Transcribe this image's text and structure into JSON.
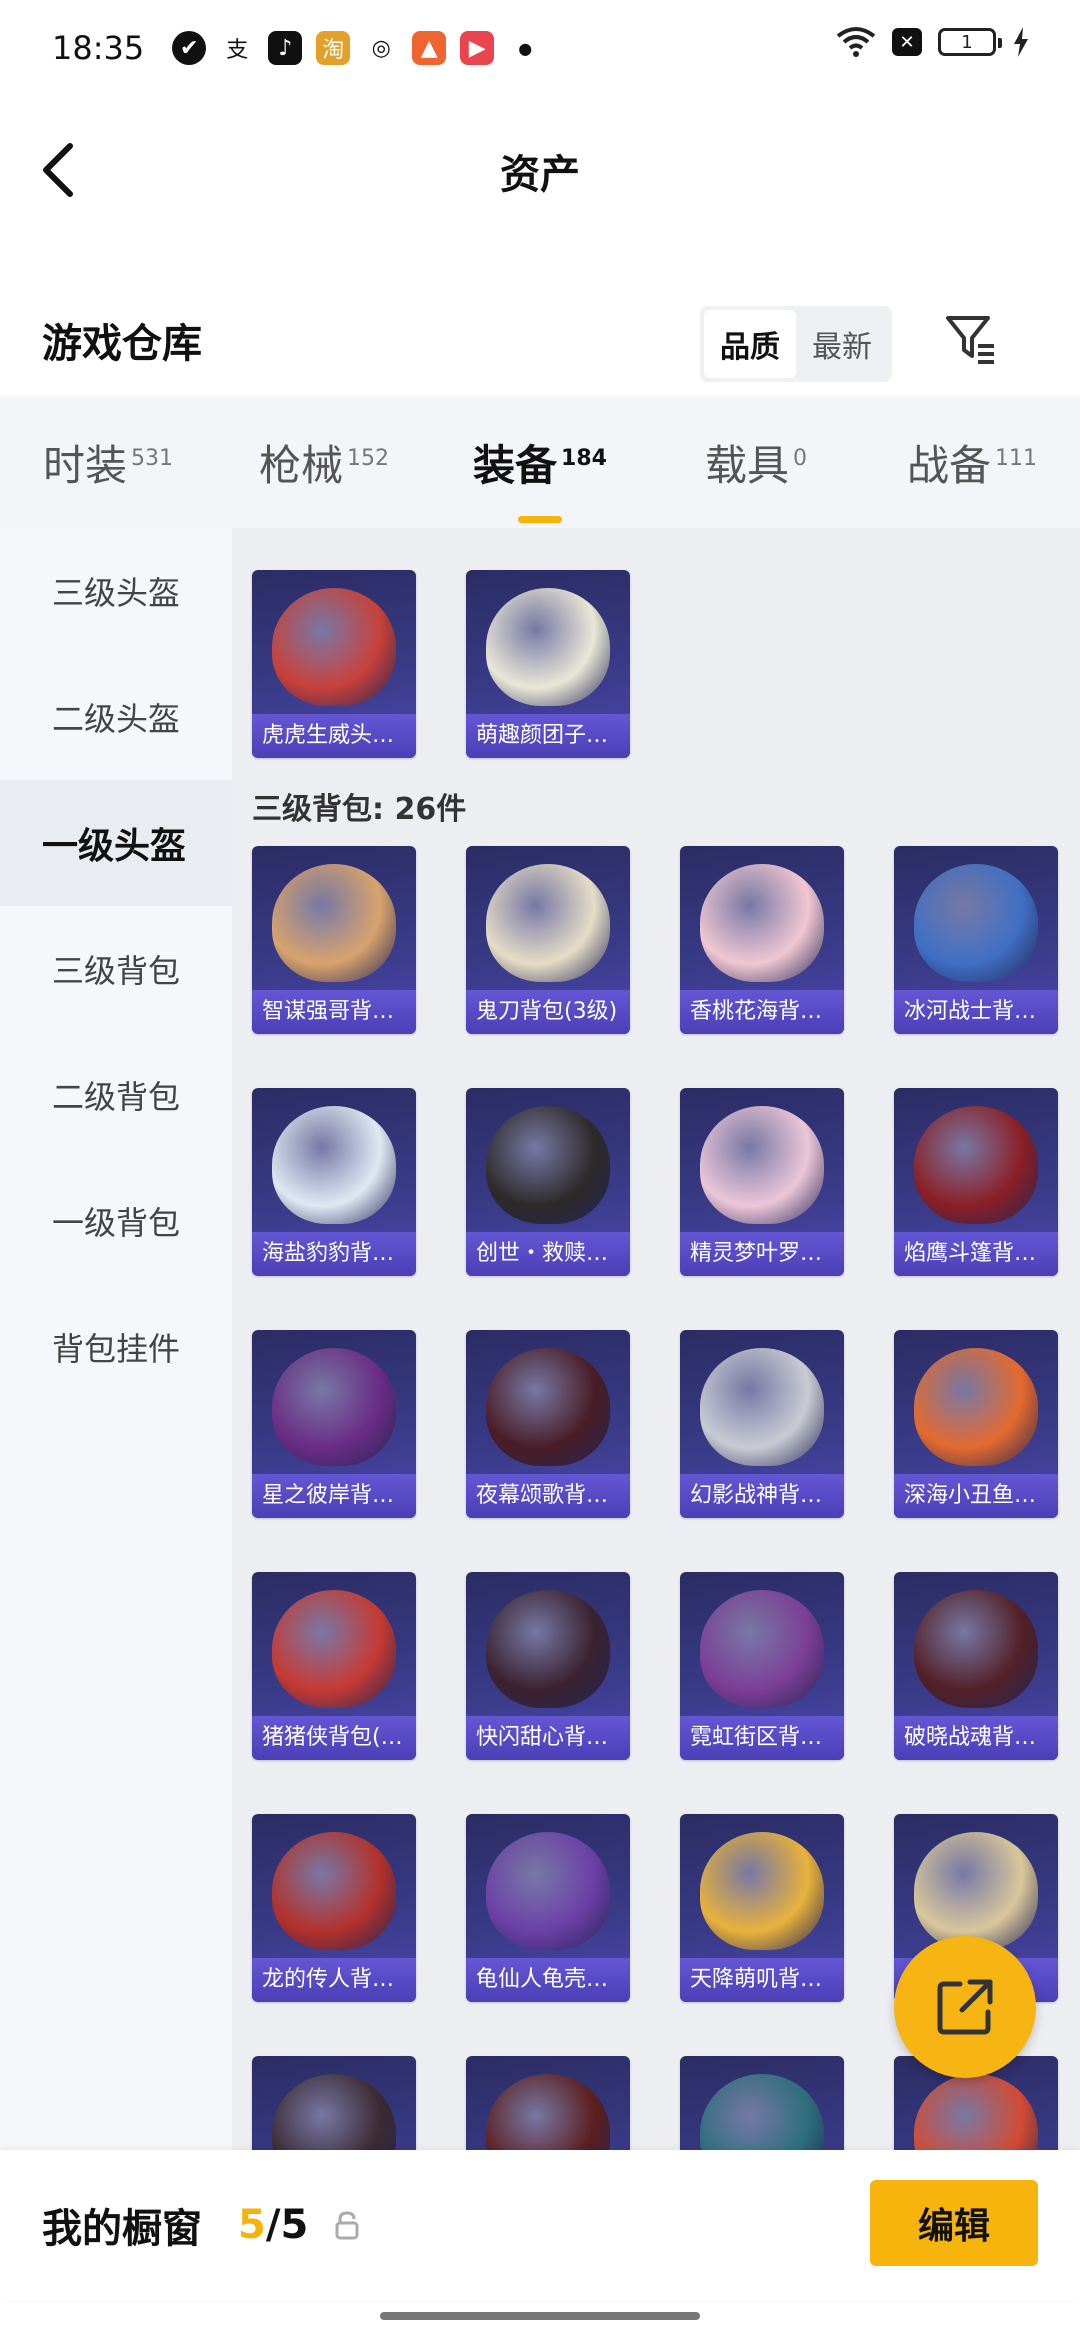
{
  "status_bar": {
    "time": "18:35",
    "battery": "1"
  },
  "header": {
    "title": "资产"
  },
  "section": {
    "title": "游戏仓库",
    "sort_options": [
      "品质",
      "最新"
    ],
    "active_sort": "品质"
  },
  "tabs": [
    {
      "label": "时装",
      "count": "531"
    },
    {
      "label": "枪械",
      "count": "152"
    },
    {
      "label": "装备",
      "count": "184"
    },
    {
      "label": "载具",
      "count": "0"
    },
    {
      "label": "战备",
      "count": "111"
    }
  ],
  "active_tab": "装备",
  "sidebar": {
    "items": [
      "三级头盔",
      "二级头盔",
      "一级头盔",
      "三级背包",
      "二级背包",
      "一级背包",
      "背包挂件"
    ],
    "active": "一级头盔"
  },
  "helmets": [
    {
      "name": "虎虎生威头…",
      "color": "#c8413a"
    },
    {
      "name": "萌趣颜团子…",
      "color": "#e9e7d6"
    }
  ],
  "backpack_section": {
    "title": "三级背包: 26件"
  },
  "backpacks": [
    {
      "name": "智谋强哥背…",
      "color": "#d8a36c"
    },
    {
      "name": "鬼刀背包(3级)",
      "color": "#e6ddc6"
    },
    {
      "name": "香桃花海背…",
      "color": "#f1c7d2"
    },
    {
      "name": "冰河战士背…",
      "color": "#3f6fc4"
    },
    {
      "name": "海盐豹豹背…",
      "color": "#dfe9f3"
    },
    {
      "name": "创世・救赎…",
      "color": "#2d2a2a"
    },
    {
      "name": "精灵梦叶罗…",
      "color": "#ecc6d8"
    },
    {
      "name": "焰鹰斗篷背…",
      "color": "#8b1f25"
    },
    {
      "name": "星之彼岸背…",
      "color": "#6a2c85"
    },
    {
      "name": "夜幕颂歌背…",
      "color": "#4a1d26"
    },
    {
      "name": "幻影战神背…",
      "color": "#c9cbd3"
    },
    {
      "name": "深海小丑鱼…",
      "color": "#e46a2e"
    },
    {
      "name": "猪猪侠背包(…",
      "color": "#c63a34"
    },
    {
      "name": "快闪甜心背…",
      "color": "#3b2230"
    },
    {
      "name": "霓虹街区背…",
      "color": "#7c3e96"
    },
    {
      "name": "破晓战魂背…",
      "color": "#532027"
    },
    {
      "name": "龙的传人背…",
      "color": "#b3312b"
    },
    {
      "name": "龟仙人龟壳…",
      "color": "#6b3fa6"
    },
    {
      "name": "天降萌叽背…",
      "color": "#e8b23b"
    },
    {
      "name": "…",
      "color": "#d9c79a"
    },
    {
      "name": "",
      "color": "#3c2a33"
    },
    {
      "name": "",
      "color": "#5c1f1f"
    },
    {
      "name": "",
      "color": "#2c6e7c"
    },
    {
      "name": "",
      "color": "#d24b32"
    }
  ],
  "bottom": {
    "title": "我的橱窗",
    "count_current": "5",
    "count_total": "/5",
    "edit_label": "编辑"
  }
}
